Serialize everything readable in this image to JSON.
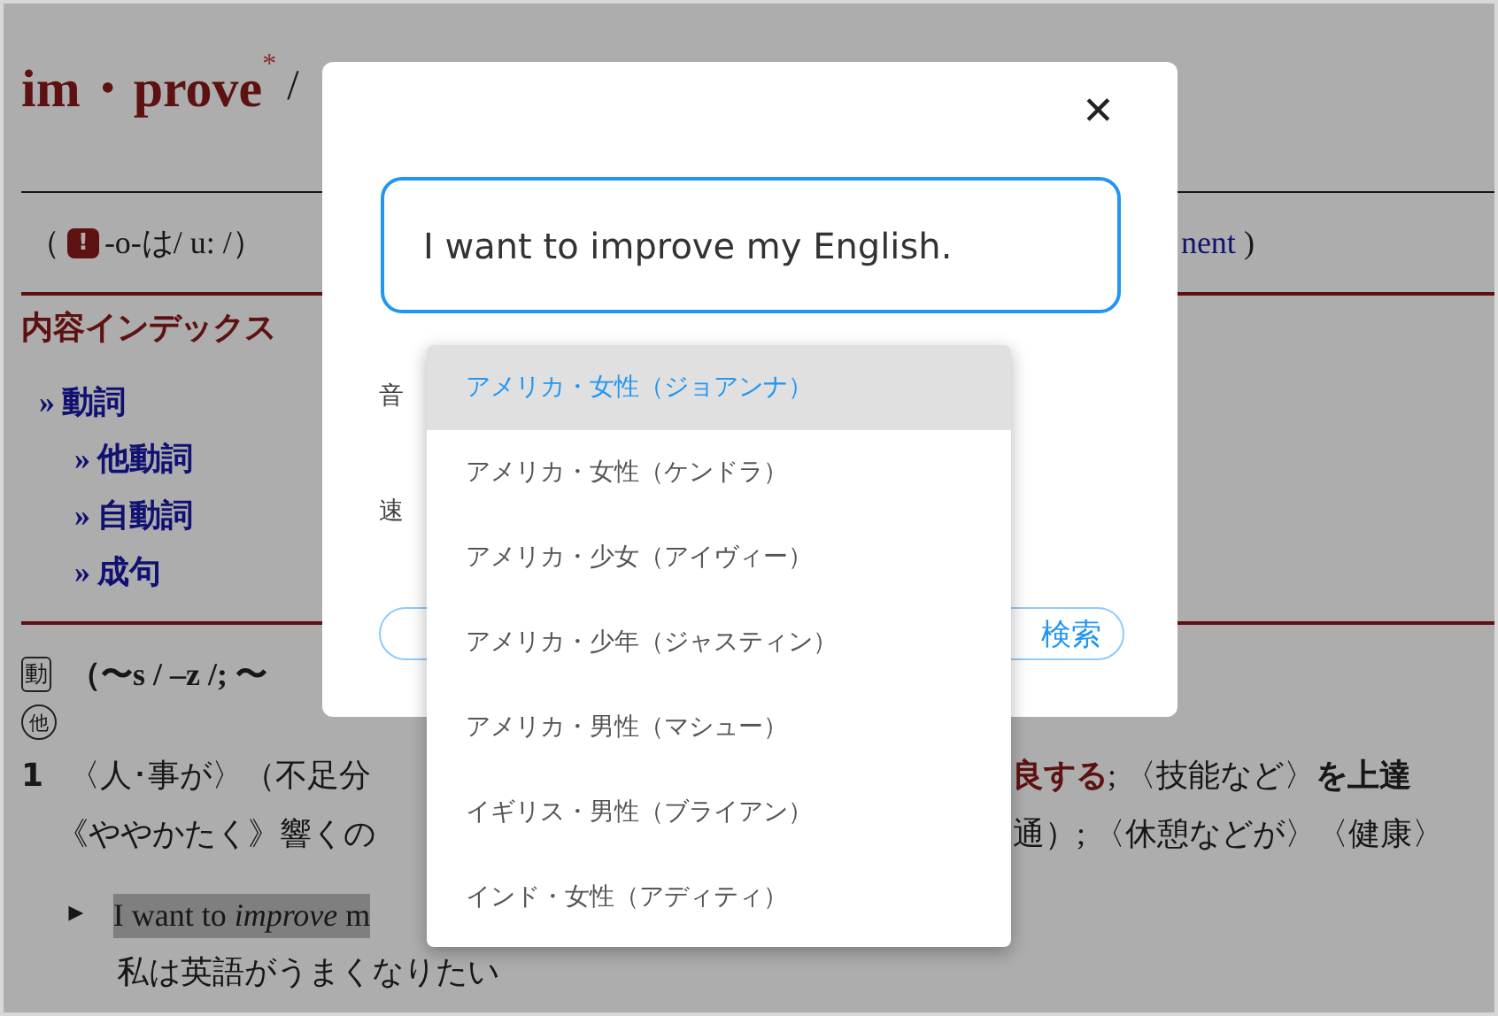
{
  "entry": {
    "headword": "im・prove",
    "star": "*",
    "slash": "/",
    "pron_open": "（",
    "pron_badge": "!",
    "pron_text": "-o-は/ u: /）",
    "pron_link": "nent",
    "pron_close": ")"
  },
  "index": {
    "title": "内容インデックス",
    "items": [
      {
        "mark": "»",
        "label": "動詞",
        "children": [
          {
            "mark": "»",
            "label": "他動詞"
          },
          {
            "mark": "»",
            "label": "自動詞"
          },
          {
            "mark": "»",
            "label": "成句"
          }
        ]
      }
    ]
  },
  "body": {
    "pos_badge": "動",
    "forms": "（〜s / –z /; 〜",
    "trans_badge": "他",
    "sense_number": "1",
    "sense_left": "〈人･事が〉（不足分",
    "sense_red": "良する",
    "sense_right": "; 〈技能など〉",
    "sense_bold": "を上達",
    "line2_left": "《ややかたく》響くの",
    "line2_right": "通）; 〈休憩などが〉〈健康〉",
    "example_marker": "►",
    "example": "I want to *improve* m",
    "translation": "私は英語がうまくなりたい"
  },
  "dialog": {
    "close": "✕",
    "input_value": "I want to improve my English.",
    "voice_label": "音",
    "speed_label": "速",
    "search_button": "検索"
  },
  "voices": [
    {
      "label": "アメリカ・女性（ジョアンナ）",
      "selected": true
    },
    {
      "label": "アメリカ・女性（ケンドラ）",
      "selected": false
    },
    {
      "label": "アメリカ・少女（アイヴィー）",
      "selected": false
    },
    {
      "label": "アメリカ・少年（ジャスティン）",
      "selected": false
    },
    {
      "label": "アメリカ・男性（マシュー）",
      "selected": false
    },
    {
      "label": "イギリス・男性（ブライアン）",
      "selected": false
    },
    {
      "label": "インド・女性（アディティ）",
      "selected": false
    }
  ]
}
